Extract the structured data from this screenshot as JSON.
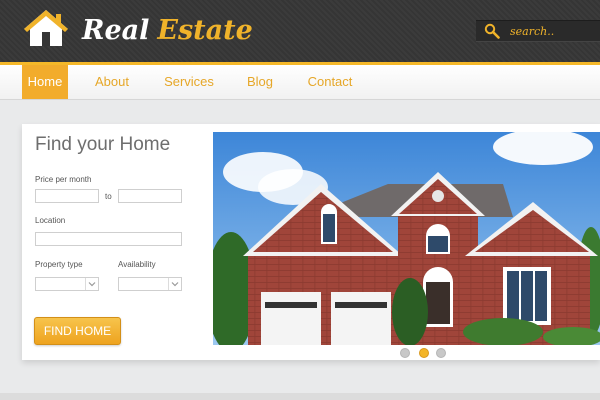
{
  "header": {
    "logo_word1": "Real",
    "logo_word2": "Estate",
    "search_placeholder": "search.."
  },
  "nav": {
    "items": [
      {
        "label": "Home",
        "active": true
      },
      {
        "label": "About"
      },
      {
        "label": "Services"
      },
      {
        "label": "Blog"
      },
      {
        "label": "Contact"
      }
    ]
  },
  "form": {
    "title": "Find your Home",
    "price_label": "Price per month",
    "to_label": "to",
    "location_label": "Location",
    "property_type_label": "Property type",
    "availability_label": "Availability",
    "button_label": "FIND HOME"
  },
  "slider": {
    "dot_count": 3,
    "active_index": 1
  },
  "colors": {
    "accent": "#f2ac2c",
    "header_bg": "#353535",
    "nav_text": "#e6a728"
  },
  "icons": {
    "logo": "house-icon",
    "search": "magnifier-icon",
    "select": "chevron-down-icon"
  }
}
